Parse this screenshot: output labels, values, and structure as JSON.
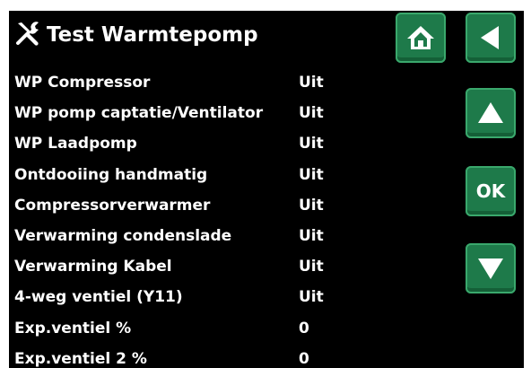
{
  "header": {
    "title": "Test Warmtepomp",
    "icon": "tools-icon"
  },
  "nav": {
    "home_icon": "home-icon",
    "back_icon": "back-arrow-icon",
    "up_icon": "up-arrow-icon",
    "ok_label": "OK",
    "down_icon": "down-arrow-icon"
  },
  "rows": [
    {
      "label": "WP Compressor",
      "value": "Uit"
    },
    {
      "label": "WP pomp captatie/Ventilator",
      "value": "Uit"
    },
    {
      "label": "WP Laadpomp",
      "value": "Uit"
    },
    {
      "label": "Ontdooiing handmatig",
      "value": "Uit"
    },
    {
      "label": "Compressorverwarmer",
      "value": "Uit"
    },
    {
      "label": "Verwarming condenslade",
      "value": "Uit"
    },
    {
      "label": "Verwarming Kabel",
      "value": "Uit"
    },
    {
      "label": "4-weg ventiel (Y11)",
      "value": "Uit"
    },
    {
      "label": "Exp.ventiel %",
      "value": "0"
    },
    {
      "label": "Exp.ventiel 2 %",
      "value": "0"
    }
  ],
  "colors": {
    "background": "#000000",
    "button": "#1e7a4a",
    "text": "#ffffff"
  }
}
